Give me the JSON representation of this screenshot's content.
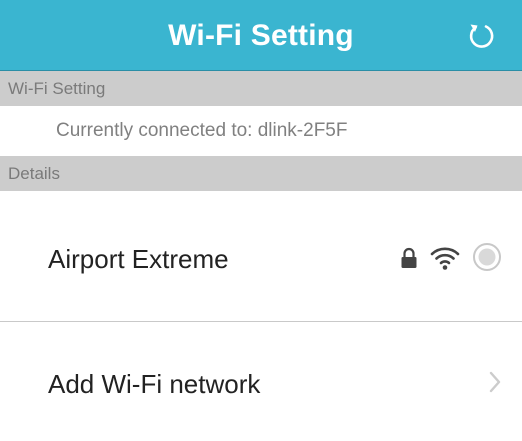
{
  "header": {
    "title": "Wi-Fi Setting",
    "refresh_icon": "refresh-icon",
    "color": "#3ab5d0"
  },
  "sections": {
    "wifi_setting_label": "Wi-Fi Setting",
    "connection_status": "Currently connected to: dlink-2F5F",
    "details_label": "Details"
  },
  "networks": [
    {
      "name": "Airport Extreme",
      "secured": true,
      "icons": [
        "lock-icon",
        "wifi-signal-icon",
        "radio-unselected-icon"
      ],
      "selected": false
    }
  ],
  "add_network": {
    "label": "Add Wi-Fi network",
    "icon": "chevron-right-icon"
  }
}
